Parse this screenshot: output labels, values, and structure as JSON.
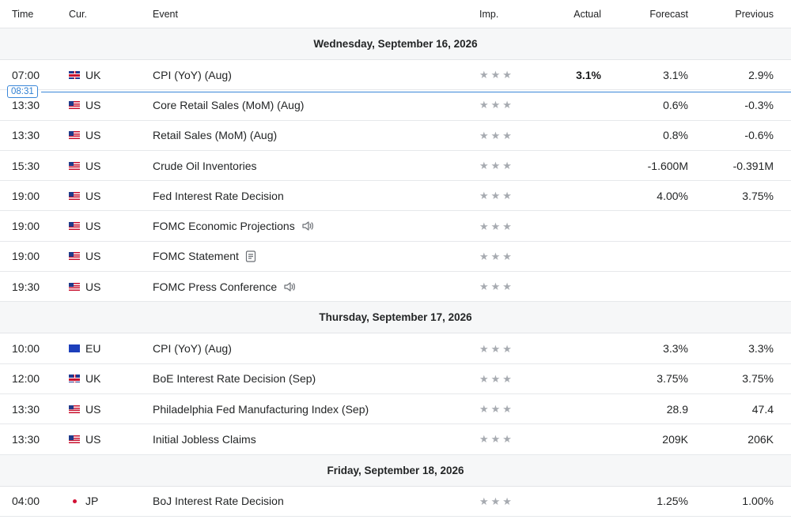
{
  "columns": {
    "time": "Time",
    "currency": "Cur.",
    "event": "Event",
    "importance": "Imp.",
    "actual": "Actual",
    "forecast": "Forecast",
    "previous": "Previous"
  },
  "now_marker": "08:31",
  "days": [
    {
      "label": "Wednesday, September 16, 2026",
      "events": [
        {
          "time": "07:00",
          "flag": "uk",
          "cur": "UK",
          "event": "CPI (YoY) (Aug)",
          "icon": "",
          "stars": "★★★",
          "actual": "3.1%",
          "forecast": "3.1%",
          "previous": "2.9%"
        },
        {
          "time": "13:30",
          "flag": "us",
          "cur": "US",
          "event": "Core Retail Sales (MoM) (Aug)",
          "icon": "",
          "stars": "★★★",
          "actual": "",
          "forecast": "0.6%",
          "previous": "-0.3%"
        },
        {
          "time": "13:30",
          "flag": "us",
          "cur": "US",
          "event": "Retail Sales (MoM) (Aug)",
          "icon": "",
          "stars": "★★★",
          "actual": "",
          "forecast": "0.8%",
          "previous": "-0.6%"
        },
        {
          "time": "15:30",
          "flag": "us",
          "cur": "US",
          "event": "Crude Oil Inventories",
          "icon": "",
          "stars": "★★★",
          "actual": "",
          "forecast": "-1.600M",
          "previous": "-0.391M"
        },
        {
          "time": "19:00",
          "flag": "us",
          "cur": "US",
          "event": "Fed Interest Rate Decision",
          "icon": "",
          "stars": "★★★",
          "actual": "",
          "forecast": "4.00%",
          "previous": "3.75%"
        },
        {
          "time": "19:00",
          "flag": "us",
          "cur": "US",
          "event": "FOMC Economic Projections",
          "icon": "speaker-icon",
          "stars": "★★★",
          "actual": "",
          "forecast": "",
          "previous": ""
        },
        {
          "time": "19:00",
          "flag": "us",
          "cur": "US",
          "event": "FOMC Statement",
          "icon": "document-icon",
          "stars": "★★★",
          "actual": "",
          "forecast": "",
          "previous": ""
        },
        {
          "time": "19:30",
          "flag": "us",
          "cur": "US",
          "event": "FOMC Press Conference",
          "icon": "speaker-icon",
          "stars": "★★★",
          "actual": "",
          "forecast": "",
          "previous": ""
        }
      ]
    },
    {
      "label": "Thursday, September 17, 2026",
      "events": [
        {
          "time": "10:00",
          "flag": "eu",
          "cur": "EU",
          "event": "CPI (YoY) (Aug)",
          "icon": "",
          "stars": "★★★",
          "actual": "",
          "forecast": "3.3%",
          "previous": "3.3%"
        },
        {
          "time": "12:00",
          "flag": "uk",
          "cur": "UK",
          "event": "BoE Interest Rate Decision  (Sep)",
          "icon": "",
          "stars": "★★★",
          "actual": "",
          "forecast": "3.75%",
          "previous": "3.75%"
        },
        {
          "time": "13:30",
          "flag": "us",
          "cur": "US",
          "event": "Philadelphia Fed Manufacturing Index  (Sep)",
          "icon": "",
          "stars": "★★★",
          "actual": "",
          "forecast": "28.9",
          "previous": "47.4"
        },
        {
          "time": "13:30",
          "flag": "us",
          "cur": "US",
          "event": "Initial Jobless Claims",
          "icon": "",
          "stars": "★★★",
          "actual": "",
          "forecast": "209K",
          "previous": "206K"
        }
      ]
    },
    {
      "label": "Friday, September 18, 2026",
      "events": [
        {
          "time": "04:00",
          "flag": "jp",
          "cur": "JP",
          "event": "BoJ Interest Rate Decision",
          "icon": "",
          "stars": "★★★",
          "actual": "",
          "forecast": "1.25%",
          "previous": "1.00%"
        }
      ]
    }
  ]
}
